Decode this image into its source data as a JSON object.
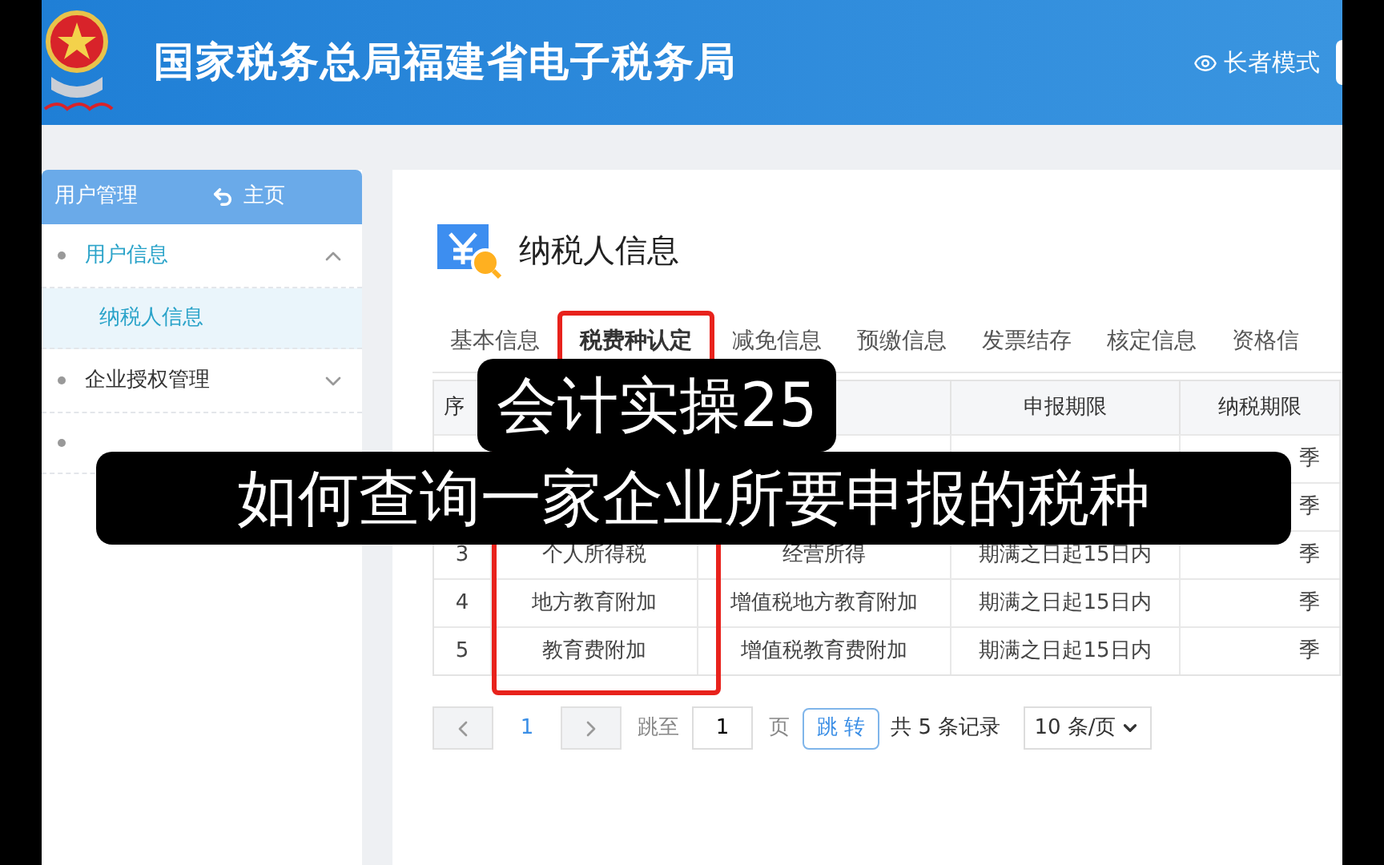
{
  "header": {
    "title": "国家税务总局福建省电子税务局",
    "elder_mode": "长者模式"
  },
  "sidebar": {
    "title": "用户管理",
    "home": "主页",
    "items": [
      {
        "label": "用户信息",
        "expanded": true,
        "children": [
          {
            "label": "纳税人信息",
            "selected": true
          }
        ]
      },
      {
        "label": "企业授权管理",
        "expanded": false
      }
    ]
  },
  "page_title": "纳税人信息",
  "tabs": [
    {
      "label": "基本信息",
      "selected": false
    },
    {
      "label": "税费种认定",
      "selected": true
    },
    {
      "label": "减免信息",
      "selected": false
    },
    {
      "label": "预缴信息",
      "selected": false
    },
    {
      "label": "发票结存",
      "selected": false
    },
    {
      "label": "核定信息",
      "selected": false
    },
    {
      "label": "资格信",
      "selected": false
    }
  ],
  "table": {
    "columns": {
      "index": "序",
      "deadline": "申报期限",
      "period": "纳税期限"
    },
    "highlight_column": true,
    "rows": [
      {
        "period": "季"
      },
      {
        "period": "季"
      },
      {
        "index": "3",
        "tax_type": "个人所得税",
        "item": "经营所得",
        "deadline": "期满之日起15日内",
        "period": "季"
      },
      {
        "index": "4",
        "tax_type": "地方教育附加",
        "item": "增值税地方教育附加",
        "deadline": "期满之日起15日内",
        "period": "季"
      },
      {
        "index": "5",
        "tax_type": "教育费附加",
        "item": "增值税教育费附加",
        "deadline": "期满之日起15日内",
        "period": "季"
      }
    ]
  },
  "pagination": {
    "page": "1",
    "jump_label": "跳至",
    "jump_value": "1",
    "page_unit": "页",
    "jump_button": "跳 转",
    "total": "共 5 条记录",
    "page_size": "10 条/页"
  },
  "captions": [
    "会计实操25",
    "如何查询一家企业所要申报的税种"
  ]
}
